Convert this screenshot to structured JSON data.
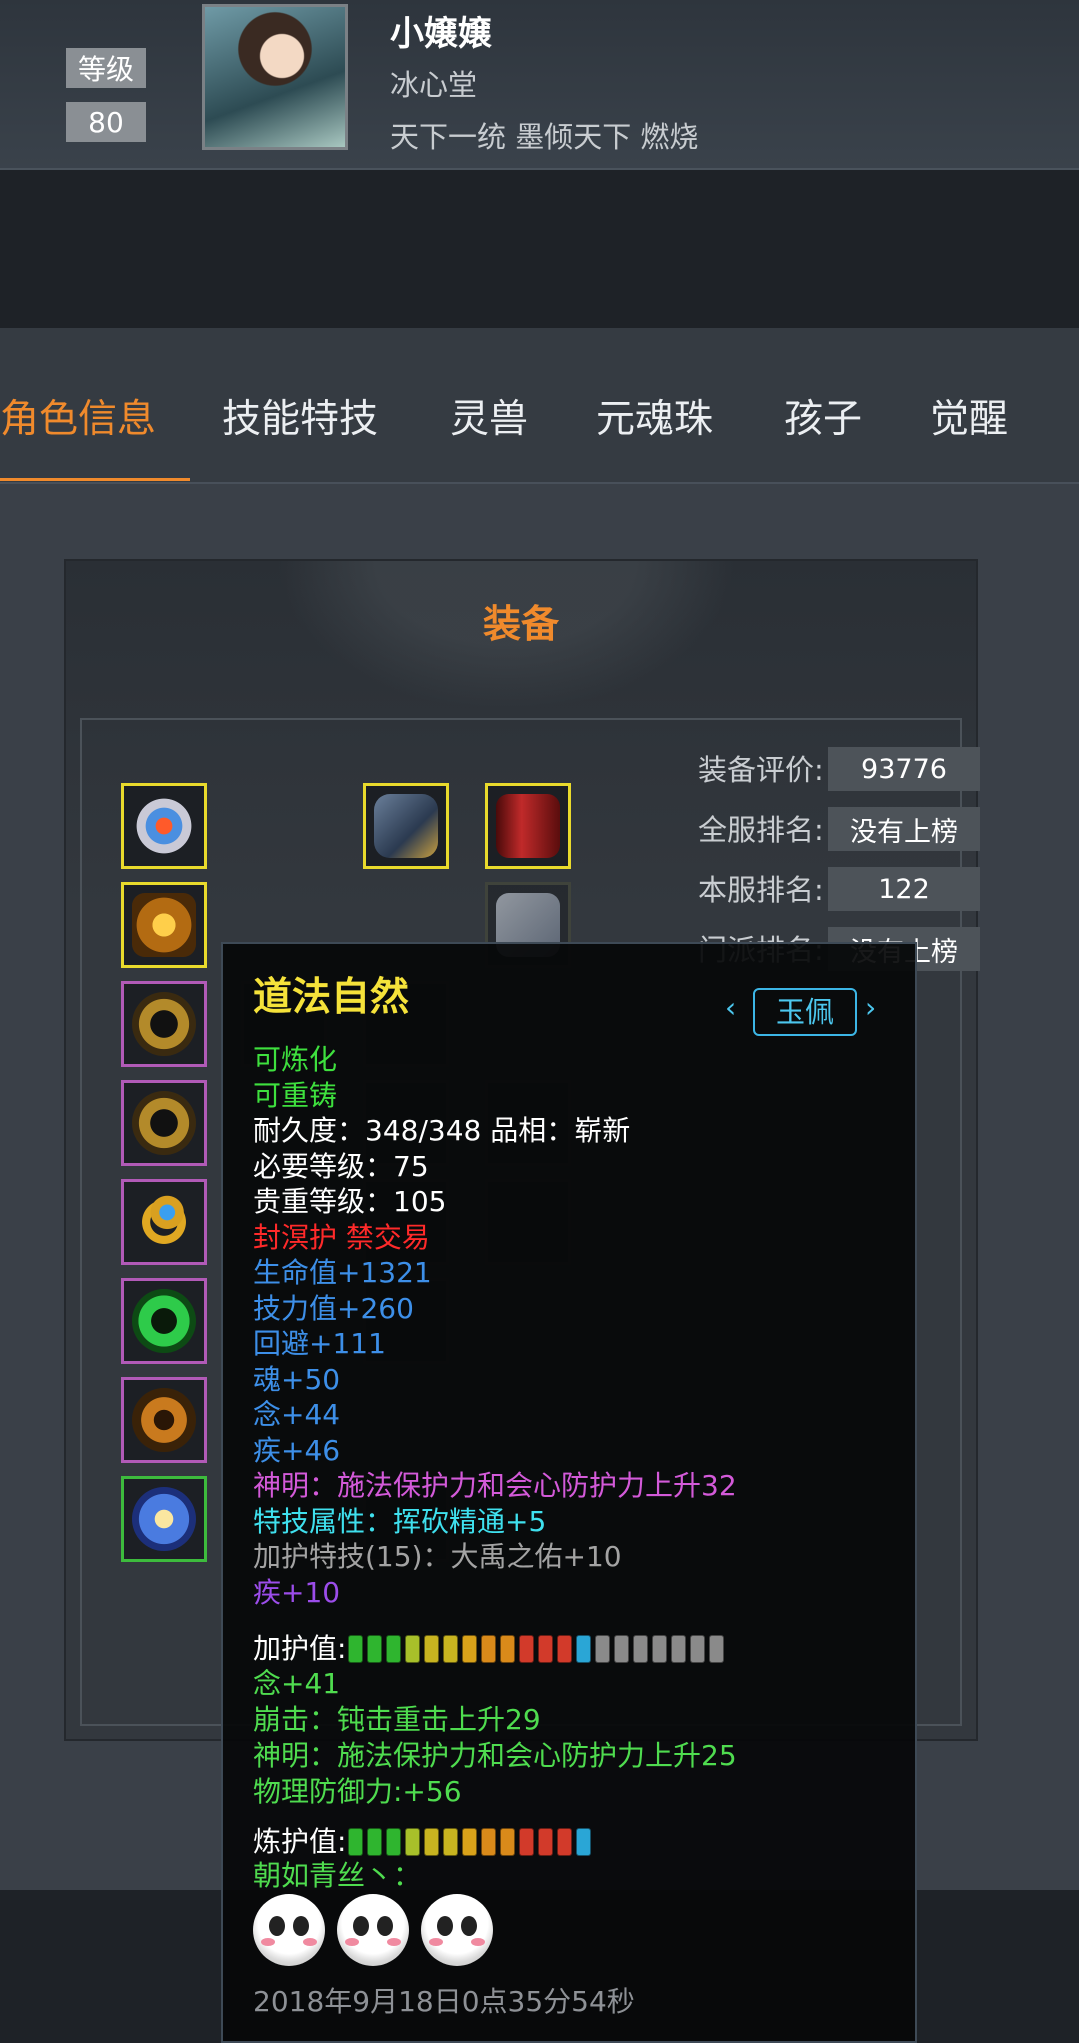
{
  "header": {
    "level_label": "等级",
    "level_value": "80",
    "name": "小嬢嬢",
    "guild": "冰心堂",
    "titles": "天下一统 墨倾天下 燃烧"
  },
  "tabs": [
    {
      "label": "角色信息",
      "active": true
    },
    {
      "label": "技能特技"
    },
    {
      "label": "灵兽"
    },
    {
      "label": "元魂珠"
    },
    {
      "label": "孩子"
    },
    {
      "label": "觉醒"
    }
  ],
  "equip": {
    "title": "装备",
    "stats": [
      {
        "label": "装备评价:",
        "value": "93776"
      },
      {
        "label": "全服排名:",
        "value": "没有上榜"
      },
      {
        "label": "本服排名:",
        "value": "122"
      },
      {
        "label": "门派排名:",
        "value": "没有上榜"
      }
    ]
  },
  "tooltip": {
    "item_name": "道法自然",
    "item_type": "玉佩",
    "lines": [
      {
        "text": "可炼化",
        "color": "#3ee03e"
      },
      {
        "text": "可重铸",
        "color": "#3ee03e"
      },
      {
        "text": "耐久度：348/348   品相：崭新",
        "color": "#ffffff"
      },
      {
        "text": "必要等级：75",
        "color": "#ffffff"
      },
      {
        "text": "贵重等级：105",
        "color": "#ffffff"
      },
      {
        "text": "封溟护 禁交易",
        "color": "#ff2a2a"
      },
      {
        "text": "生命值+1321",
        "color": "#3d8fe8"
      },
      {
        "text": "技力值+260",
        "color": "#3d8fe8"
      },
      {
        "text": "回避+111",
        "color": "#3d8fe8"
      },
      {
        "text": "魂+50",
        "color": "#3d8fe8"
      },
      {
        "text": "念+44",
        "color": "#3d8fe8"
      },
      {
        "text": "疾+46",
        "color": "#3d8fe8"
      },
      {
        "text": "神明：施法保护力和会心防护力上升32",
        "color": "#d35ad9"
      },
      {
        "text": "特技属性：挥砍精通+5",
        "color": "#3fe0ee"
      },
      {
        "text": "加护特技(15)：大禹之佑+10",
        "color": "#a3a3a3"
      },
      {
        "text": "疾+10",
        "color": "#9b4dea"
      }
    ],
    "jiahu_label": "加护值:",
    "jiahu_pips": [
      "#2fb52f",
      "#2fb52f",
      "#2fb52f",
      "#a8c02a",
      "#c8b420",
      "#c8b420",
      "#d9a21a",
      "#d98a1a",
      "#d98a1a",
      "#d23a2a",
      "#d23a2a",
      "#d23a2a",
      "#2aa6d6",
      "#8a8a8a",
      "#8a8a8a",
      "#8a8a8a",
      "#8a8a8a",
      "#8a8a8a",
      "#8a8a8a",
      "#8a8a8a"
    ],
    "after_jiahu": [
      {
        "text": "念+41",
        "color": "#4fdc4f"
      },
      {
        "text": "崩击：钝击重击上升29",
        "color": "#4fdc4f"
      },
      {
        "text": "神明：施法保护力和会心防护力上升25",
        "color": "#4fdc4f"
      },
      {
        "text": "物理防御力:+56",
        "color": "#4fdc4f"
      }
    ],
    "lianhu_label": "炼护值:",
    "lianhu_pips": [
      "#2fb52f",
      "#2fb52f",
      "#2fb52f",
      "#a8c02a",
      "#c8b420",
      "#c8b420",
      "#d9a21a",
      "#d98a1a",
      "#d98a1a",
      "#d23a2a",
      "#d23a2a",
      "#d23a2a",
      "#2aa6d6"
    ],
    "signature": "朝如青丝丶：",
    "date": "2018年9月18日0点35分54秒"
  }
}
